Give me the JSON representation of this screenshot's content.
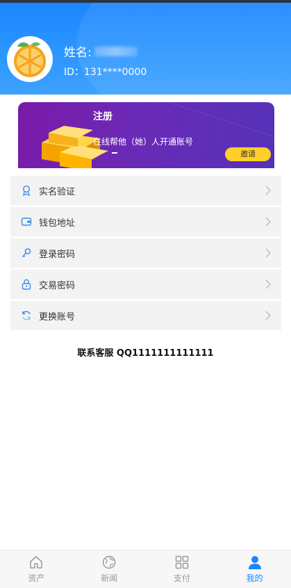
{
  "profile": {
    "name_label": "姓名:",
    "id_text": "ID：131****0000"
  },
  "banner": {
    "title": "注册",
    "description": "在线帮他（她）人开通账号",
    "invite_label": "邀请"
  },
  "menu": {
    "items": [
      {
        "label": "实名验证",
        "icon": "verify-icon"
      },
      {
        "label": "钱包地址",
        "icon": "wallet-icon"
      },
      {
        "label": "登录密码",
        "icon": "key-icon"
      },
      {
        "label": "交易密码",
        "icon": "lock-icon"
      },
      {
        "label": "更换账号",
        "icon": "refresh-icon"
      }
    ]
  },
  "contact": "联系客服 QQ1111111111111",
  "tabs": [
    {
      "label": "资产",
      "icon": "home-icon",
      "active": false
    },
    {
      "label": "新闻",
      "icon": "globe-icon",
      "active": false
    },
    {
      "label": "支付",
      "icon": "grid-icon",
      "active": false
    },
    {
      "label": "我的",
      "icon": "user-icon",
      "active": true
    }
  ],
  "colors": {
    "header_blue": "#1b86ff",
    "banner_purple": "#6a2ab6",
    "invite_yellow": "#ffcf2a",
    "active_tab": "#1b86ff"
  }
}
